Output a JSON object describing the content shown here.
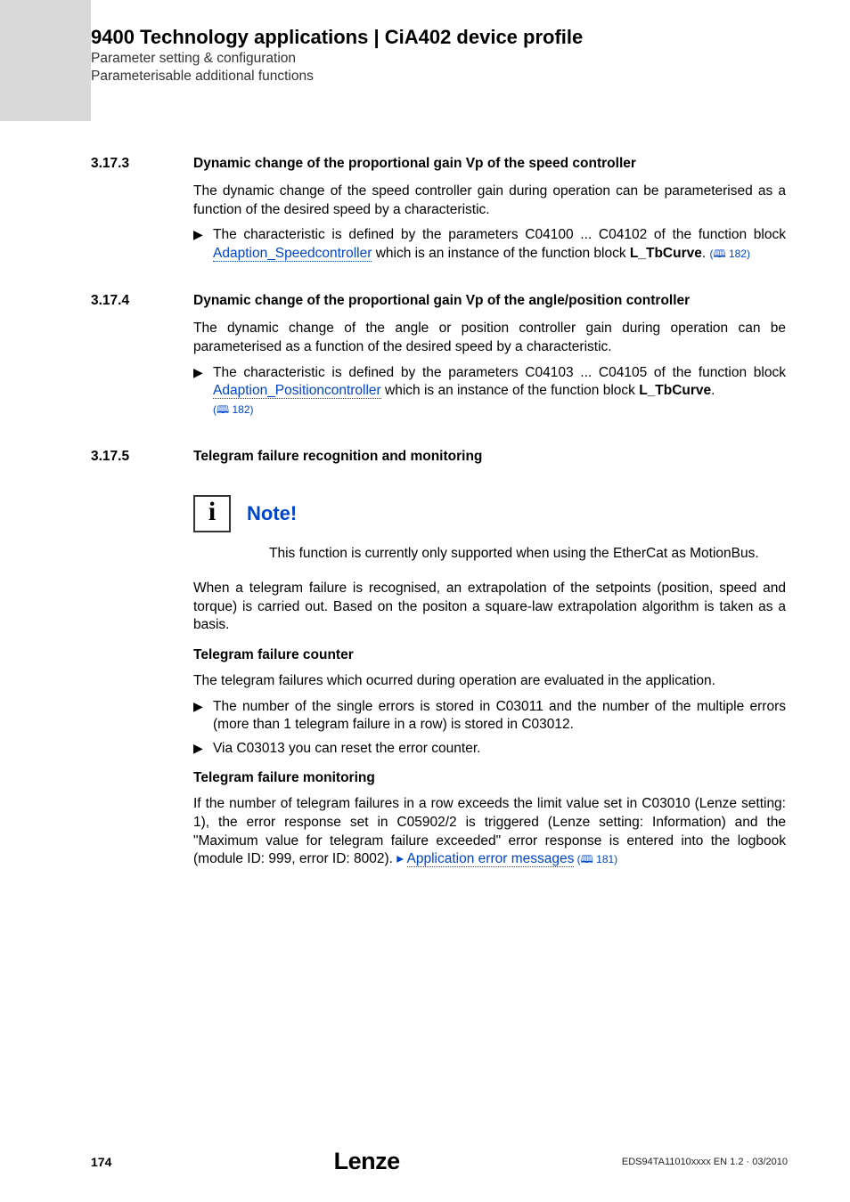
{
  "header": {
    "title": "9400 Technology applications | CiA402 device profile",
    "line1": "Parameter setting & configuration",
    "line2": "Parameterisable additional functions"
  },
  "s3173": {
    "num": "3.17.3",
    "heading": "Dynamic change of the proportional gain Vp of the speed controller",
    "p1": "The dynamic change of the speed controller gain during operation can be parameterised as a function of the desired speed by a characteristic.",
    "b1_pre": "The characteristic is defined by the parameters C04100 ... C04102 of the function block ",
    "b1_link": "Adaption_Speedcontroller",
    "b1_mid": " which is an instance of the function block ",
    "b1_bold": "L_TbCurve",
    "b1_post": ". ",
    "b1_ref": "(🕮 182)"
  },
  "s3174": {
    "num": "3.17.4",
    "heading": "Dynamic change of the proportional gain Vp of the angle/position controller",
    "p1": "The dynamic change of the angle or position controller gain during operation can be parameterised as a function of the desired speed by a characteristic.",
    "b1_pre": "The characteristic is defined by the parameters C04103 ... C04105 of the function block ",
    "b1_link": "Adaption_Positioncontroller",
    "b1_mid": " which is an instance of the function block ",
    "b1_bold": "L_TbCurve",
    "b1_post": ".",
    "b1_ref": "(🕮 182)"
  },
  "s3175": {
    "num": "3.17.5",
    "heading": "Telegram failure recognition and monitoring",
    "note_label": "Note!",
    "note_text": "This function is currently only supported when using the EtherCat as MotionBus.",
    "p1": "When a telegram failure is recognised, an extrapolation of the setpoints (position, speed and torque) is carried out. Based on the positon a square-law extrapolation algorithm is taken as a basis.",
    "sub1": "Telegram failure counter",
    "sub1_p1": "The telegram failures which ocurred during operation are evaluated in the application.",
    "sub1_b1": "The number of the single errors is stored in C03011 and the number of the multiple errors (more than 1 telegram failure in a row) is stored in C03012.",
    "sub1_b2": "Via C03013 you can reset the error counter.",
    "sub2": "Telegram failure monitoring",
    "sub2_p1_pre": "If the number of telegram failures in a row exceeds the limit value set in C03010 (Lenze setting: 1), the error response set in C05902/2 is triggered (Lenze setting: Information) and the \"Maximum value for telegram failure exceeded\" error response is entered into the logbook (module ID: 999, error ID: 8002).  ",
    "sub2_link": "Application error messages",
    "sub2_ref": " (🕮 181)"
  },
  "footer": {
    "page": "174",
    "logo": "Lenze",
    "code": "EDS94TA11010xxxx EN 1.2 · 03/2010"
  }
}
